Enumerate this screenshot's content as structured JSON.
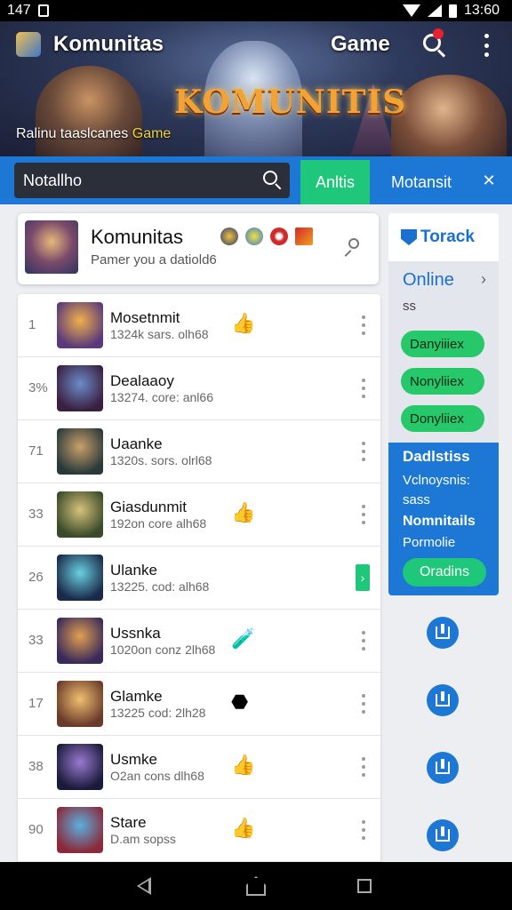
{
  "status_bar": {
    "time_left": "147",
    "time_right": "13:60"
  },
  "header": {
    "app_title": "Komunitas",
    "game_label": "Game",
    "logo_text": "KOMUNITIS",
    "tagline_prefix": "Ralinu taaslcanes",
    "tagline_highlight": "Game"
  },
  "search": {
    "placeholder": "Notallho"
  },
  "tabs": {
    "active": "Anltis",
    "second": "Motansit",
    "close_glyph": "✕"
  },
  "community": {
    "title": "Komunitas",
    "subtitle": "Pamer you a datiold6"
  },
  "list": [
    {
      "rank": "1",
      "name": "Mosetnmit",
      "meta": "1324k sars. olh68",
      "emoji": "👍",
      "action": "menu",
      "avatar_colors": [
        "#f0b04a",
        "#5a3a7a"
      ]
    },
    {
      "rank": "3%",
      "name": "Dealaaoy",
      "meta": "13274. core: anl66",
      "emoji": "",
      "action": "menu",
      "avatar_colors": [
        "#6b8cc9",
        "#3a2040"
      ]
    },
    {
      "rank": "71",
      "name": "Uaanke",
      "meta": "1320s. sors. olrl68",
      "emoji": "",
      "action": "menu",
      "avatar_colors": [
        "#c9a06a",
        "#2a3a3a"
      ]
    },
    {
      "rank": "33",
      "name": "Giasdunmit",
      "meta": "192on core alh68",
      "emoji": "👍",
      "action": "menu",
      "avatar_colors": [
        "#d6c27a",
        "#3a4a2a"
      ]
    },
    {
      "rank": "26",
      "name": "Ulanke",
      "meta": "13225. cod: alh68",
      "emoji": "",
      "action": "go",
      "avatar_colors": [
        "#6ad0e0",
        "#1a2a4a"
      ]
    },
    {
      "rank": "33",
      "name": "Ussnka",
      "meta": "1020on conz 2lh68",
      "emoji": "🧪",
      "action": "menu",
      "avatar_colors": [
        "#e0a050",
        "#3a2a5a"
      ]
    },
    {
      "rank": "17",
      "name": "Glamke",
      "meta": "13225 cod: 2lh28",
      "emoji": "⬣",
      "action": "menu",
      "avatar_colors": [
        "#f0c070",
        "#6a3a2a"
      ]
    },
    {
      "rank": "38",
      "name": "Usmke",
      "meta": "O2an cons dlh68",
      "emoji": "👍",
      "action": "menu",
      "avatar_colors": [
        "#9a7ad0",
        "#1a1a3a"
      ]
    },
    {
      "rank": "90",
      "name": "Stare",
      "meta": "D.am sopss",
      "emoji": "👍",
      "action": "menu",
      "avatar_colors": [
        "#5ab0e0",
        "#8a2a3a"
      ]
    }
  ],
  "side": {
    "tracker": "Torack",
    "online": "Online",
    "online_sub": "ss",
    "pills": [
      "Danyiiiex",
      "Nonyliiex",
      "Donyliiex"
    ],
    "blue_title": "Dadlstiss",
    "blue_text": "Vclnoysnis: sass",
    "blue_title2": "Nomnitails",
    "blue_text2": "Pormolie",
    "blue_button": "Oradins"
  }
}
